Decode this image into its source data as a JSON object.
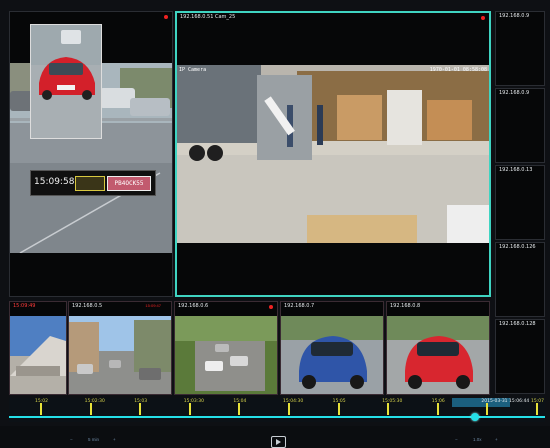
{
  "main_left": {
    "overlay_time": "15:09:58",
    "plate_text": "PB4OCK55"
  },
  "center": {
    "label": "192.168.0.51 Cam_25",
    "osd_name": "IP Camera",
    "osd_datetime": "1970-01-01 08:58:08"
  },
  "right_column": [
    {
      "label": "192.168.0.9"
    },
    {
      "label": "192.168.0.9"
    },
    {
      "label": "192.168.0.13"
    },
    {
      "label": "192.168.0.126"
    },
    {
      "label": "192.168.0.128"
    }
  ],
  "bottom_row": [
    {
      "label": "15:09:49"
    },
    {
      "label": "192.168.0.5",
      "time": "15:09:47"
    },
    {
      "label": "192.168.0.6"
    },
    {
      "label": "192.168.0.7"
    },
    {
      "label": "192.168.0.8"
    }
  ],
  "timeline": {
    "labels": [
      "15:02",
      "15:02:30",
      "15:03",
      "15:03:30",
      "15:04",
      "15:04:30",
      "15:05",
      "15:05:30",
      "15:06",
      "2015-03-31 15:06:44",
      "15:07"
    ],
    "progress": 0.87
  },
  "controls": {
    "left_value": "5 min",
    "right_value": "1.0x"
  },
  "colors": {
    "accent": "#25e0e8",
    "active_border": "#3fd4c2",
    "record_red": "#e22222",
    "tick_yellow": "#e8e23a"
  }
}
